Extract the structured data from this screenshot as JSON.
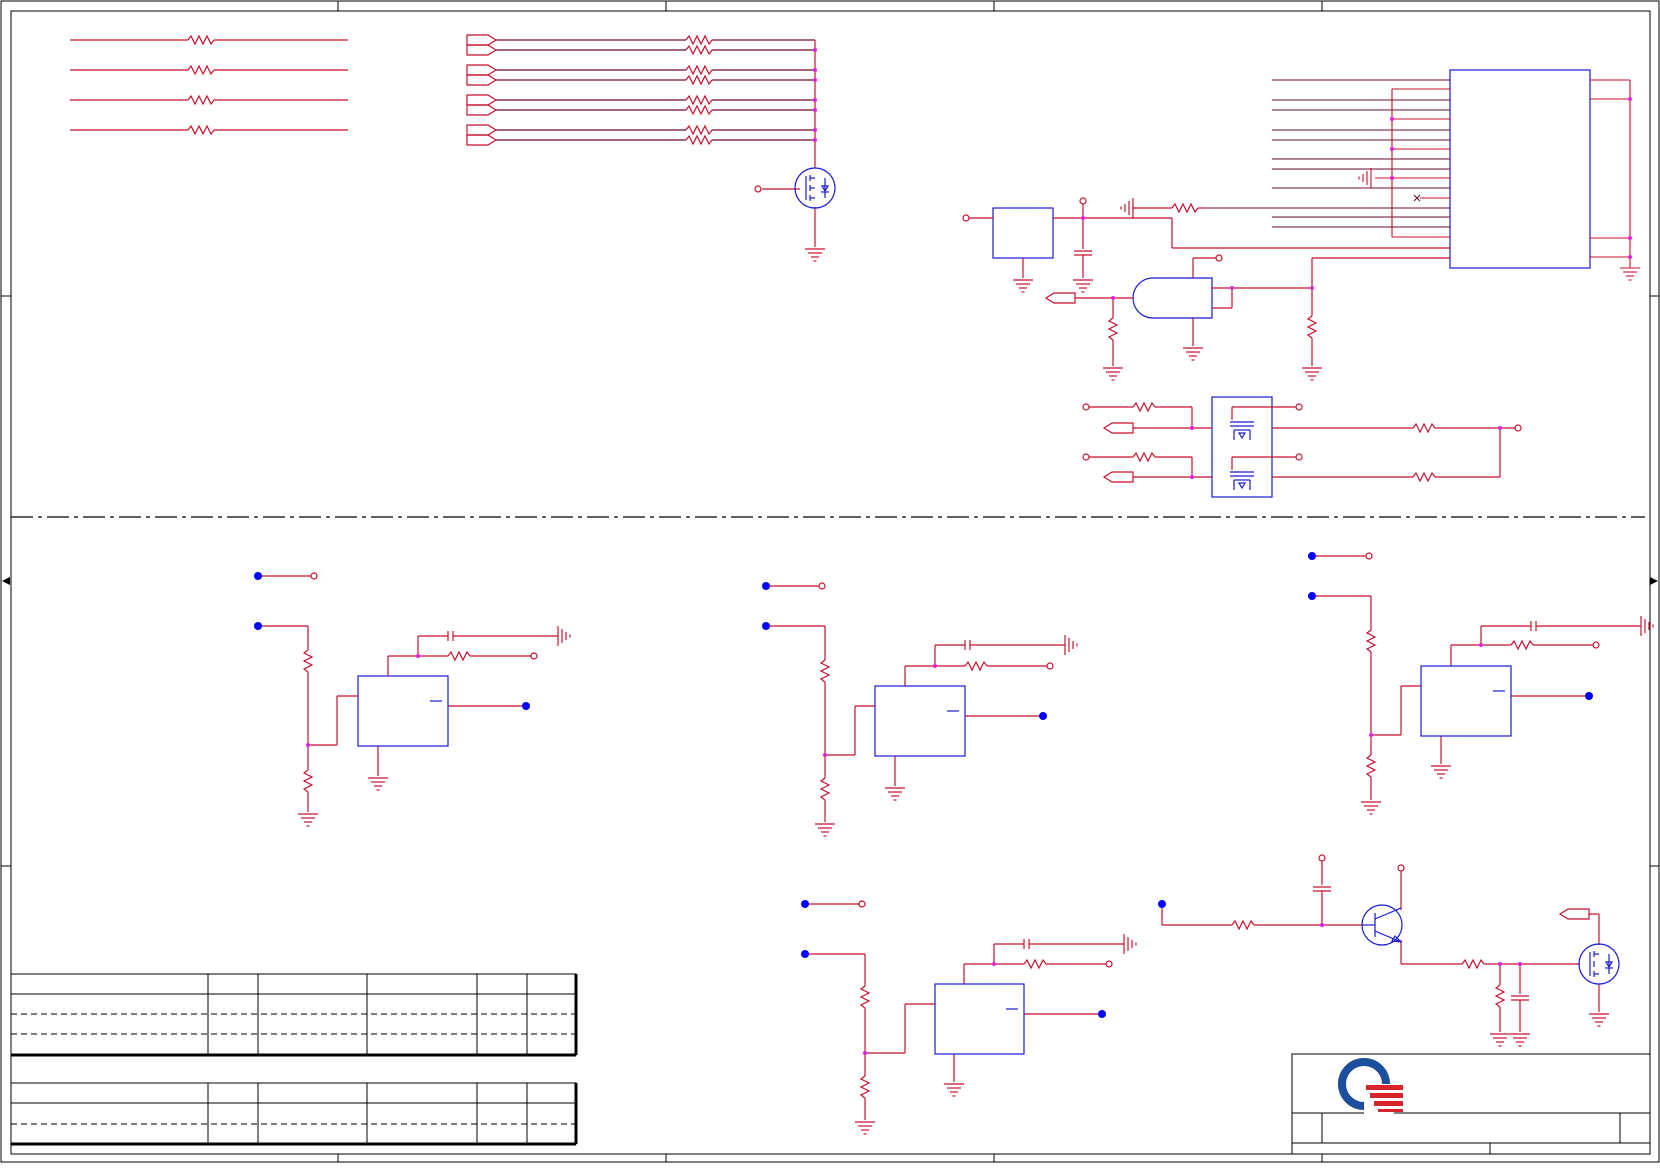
{
  "sheet": {
    "wire_color": "#c8102e",
    "net_color": "#6a0d2e",
    "part_color": "#1a1ad0",
    "junction_color": "#e020e0",
    "pin_color": "#0000ff",
    "frame_color": "#000000"
  },
  "logo": {
    "ring_color": "#1b4f9c",
    "bars_color": "#d8232a"
  }
}
